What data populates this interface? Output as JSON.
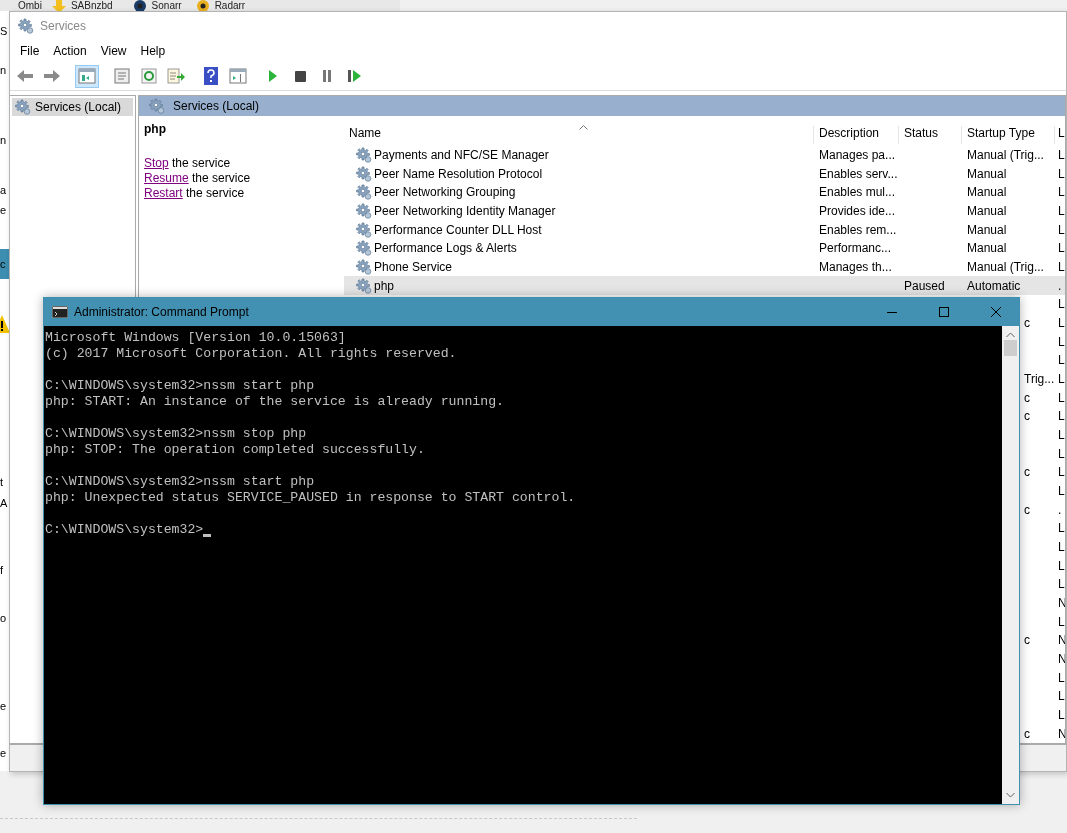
{
  "bookmarks": [
    {
      "label": "Ombi"
    },
    {
      "label": "SABnzbd"
    },
    {
      "label": "Sonarr"
    },
    {
      "label": "Radarr"
    }
  ],
  "back_window": {
    "fragments": [
      "S",
      "n",
      "n",
      "a",
      "e",
      "c",
      "t",
      "A",
      "f",
      "o",
      "e",
      "e"
    ]
  },
  "services_window": {
    "title": "Services",
    "menu": [
      "File",
      "Action",
      "View",
      "Help"
    ],
    "toolbar": [
      {
        "kind": "back",
        "pressed": false
      },
      {
        "kind": "forward",
        "pressed": false
      },
      {
        "kind": "tree",
        "pressed": true
      },
      {
        "kind": "properties",
        "pressed": false
      },
      {
        "kind": "refresh",
        "pressed": false
      },
      {
        "kind": "export",
        "pressed": false
      },
      {
        "kind": "help",
        "pressed": false
      },
      {
        "kind": "console",
        "pressed": false
      },
      {
        "kind": "start",
        "pressed": false
      },
      {
        "kind": "stop",
        "pressed": false
      },
      {
        "kind": "pause",
        "pressed": false
      },
      {
        "kind": "resume",
        "pressed": false
      }
    ],
    "tree": [
      {
        "label": "Services (Local)",
        "selected": true
      }
    ],
    "pane_title": "Services (Local)",
    "detail": {
      "service_name": "php",
      "actions": [
        {
          "link": "Stop",
          "text": "the service"
        },
        {
          "link": "Resume",
          "text": "the service"
        },
        {
          "link": "Restart",
          "text": "the service"
        }
      ]
    },
    "list": {
      "columns": [
        {
          "label": "Name",
          "sorted": true
        },
        {
          "label": "Description",
          "sorted": false
        },
        {
          "label": "Status",
          "sorted": false
        },
        {
          "label": "Startup Type",
          "sorted": false
        },
        {
          "label": "L",
          "sorted": false
        }
      ],
      "rows": [
        {
          "name": "Payments and NFC/SE Manager",
          "description": "Manages pa...",
          "status": "",
          "startup_type": "Manual (Trig...",
          "column_5": "L",
          "selected": false
        },
        {
          "name": "Peer Name Resolution Protocol",
          "description": "Enables serv...",
          "status": "",
          "startup_type": "Manual",
          "column_5": "L",
          "selected": false
        },
        {
          "name": "Peer Networking Grouping",
          "description": "Enables mul...",
          "status": "",
          "startup_type": "Manual",
          "column_5": "L",
          "selected": false
        },
        {
          "name": "Peer Networking Identity Manager",
          "description": "Provides ide...",
          "status": "",
          "startup_type": "Manual",
          "column_5": "L",
          "selected": false
        },
        {
          "name": "Performance Counter DLL Host",
          "description": "Enables rem...",
          "status": "",
          "startup_type": "Manual",
          "column_5": "L",
          "selected": false
        },
        {
          "name": "Performance Logs & Alerts",
          "description": "Performanc...",
          "status": "",
          "startup_type": "Manual",
          "column_5": "L",
          "selected": false
        },
        {
          "name": "Phone Service",
          "description": "Manages th...",
          "status": "",
          "startup_type": "Manual (Trig...",
          "column_5": "L",
          "selected": false
        },
        {
          "name": "php",
          "description": "",
          "status": "Paused",
          "startup_type": "Automatic",
          "column_5": ".",
          "selected": true
        }
      ],
      "covered_rows": [
        {
          "startup_type": "",
          "column_5": "L"
        },
        {
          "startup_type": "c",
          "column_5": "L"
        },
        {
          "startup_type": "",
          "column_5": "L"
        },
        {
          "startup_type": "",
          "column_5": "L"
        },
        {
          "startup_type": "Trig...",
          "column_5": "L"
        },
        {
          "startup_type": "c",
          "column_5": "L"
        },
        {
          "startup_type": "c",
          "column_5": "L"
        },
        {
          "startup_type": "",
          "column_5": "L"
        },
        {
          "startup_type": "",
          "column_5": "L"
        },
        {
          "startup_type": "c",
          "column_5": "L"
        },
        {
          "startup_type": "",
          "column_5": "L"
        },
        {
          "startup_type": "c",
          "column_5": "."
        },
        {
          "startup_type": "",
          "column_5": "L"
        },
        {
          "startup_type": "",
          "column_5": "L"
        },
        {
          "startup_type": "",
          "column_5": "L"
        },
        {
          "startup_type": "",
          "column_5": "L"
        },
        {
          "startup_type": "",
          "column_5": "N"
        },
        {
          "startup_type": "",
          "column_5": "L"
        },
        {
          "startup_type": "c",
          "column_5": "N"
        },
        {
          "startup_type": "",
          "column_5": "N"
        },
        {
          "startup_type": "",
          "column_5": "L"
        },
        {
          "startup_type": "",
          "column_5": "L"
        },
        {
          "startup_type": "",
          "column_5": "L"
        },
        {
          "startup_type": "c",
          "column_5": "N"
        }
      ]
    }
  },
  "cmd_window": {
    "title": "Administrator: Command Prompt",
    "blocks": [
      [
        "Microsoft Windows [Version 10.0.15063]",
        "(c) 2017 Microsoft Corporation. All rights reserved."
      ],
      [
        "C:\\WINDOWS\\system32>nssm start php",
        "php: START: An instance of the service is already running."
      ],
      [
        "C:\\WINDOWS\\system32>nssm stop php",
        "php: STOP: The operation completed successfully."
      ],
      [
        "C:\\WINDOWS\\system32>nssm start php",
        "php: Unexpected status SERVICE_PAUSED in response to START control."
      ],
      [
        "C:\\WINDOWS\\system32>"
      ]
    ]
  }
}
